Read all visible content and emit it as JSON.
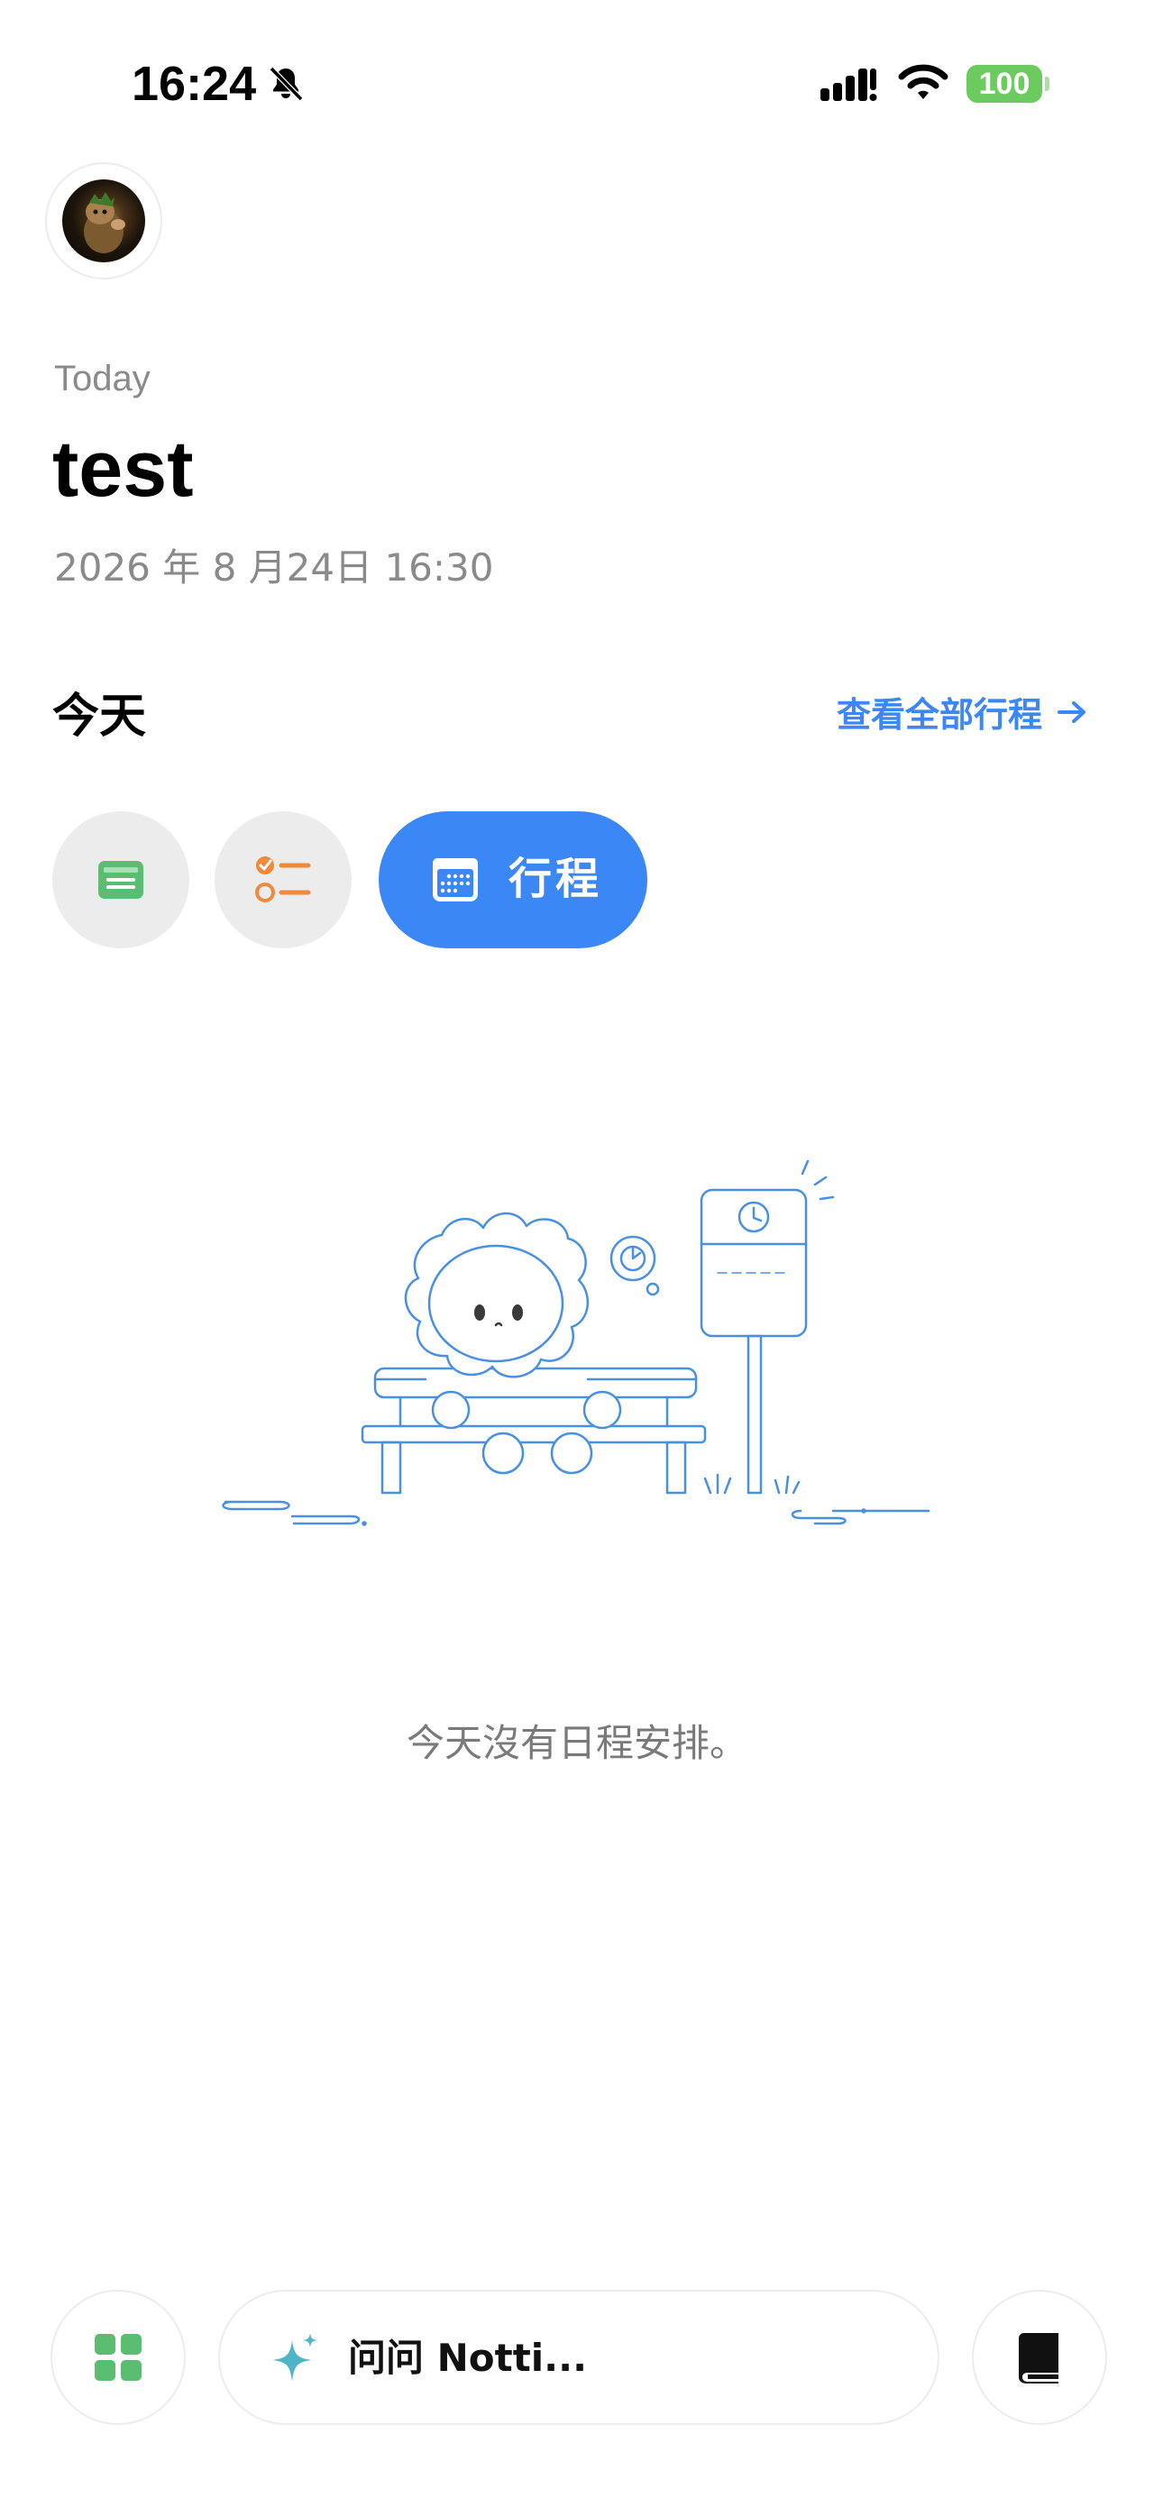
{
  "status_bar": {
    "time": "16:24",
    "battery": "100",
    "icons": [
      "bell-slash-icon",
      "cellular-signal-icon",
      "wifi-icon",
      "battery-icon"
    ]
  },
  "profile": {
    "avatar_icon": "user-avatar"
  },
  "note": {
    "label": "Today",
    "title": "test",
    "date": "2026 年 8 月24日 16:30"
  },
  "schedule_section": {
    "title": "今天",
    "view_all": "查看全部行程",
    "view_all_icon": "arrow-right-icon"
  },
  "tabs": [
    {
      "id": "notes",
      "icon": "note-card-icon",
      "color": "#5bbd72"
    },
    {
      "id": "tasks",
      "icon": "checklist-icon",
      "color": "#ef8a3c"
    },
    {
      "id": "schedule",
      "label": "行程",
      "icon": "calendar-icon",
      "selected": true,
      "color": "#3a87f5"
    }
  ],
  "empty_state": {
    "illustration": "character-waiting-at-bus-stop",
    "message": "今天沒有日程安排。"
  },
  "bottom_bar": {
    "apps_icon": "grid-icon",
    "ask_placeholder": "问问 Notti...",
    "ask_icon": "sparkle-icon",
    "library_icon": "book-icon"
  },
  "colors": {
    "accent": "#3a87f5",
    "green": "#5bbd72",
    "orange": "#ef8a3c",
    "gray_text": "#8a8a8a",
    "illustration_stroke": "#4a90e2"
  }
}
